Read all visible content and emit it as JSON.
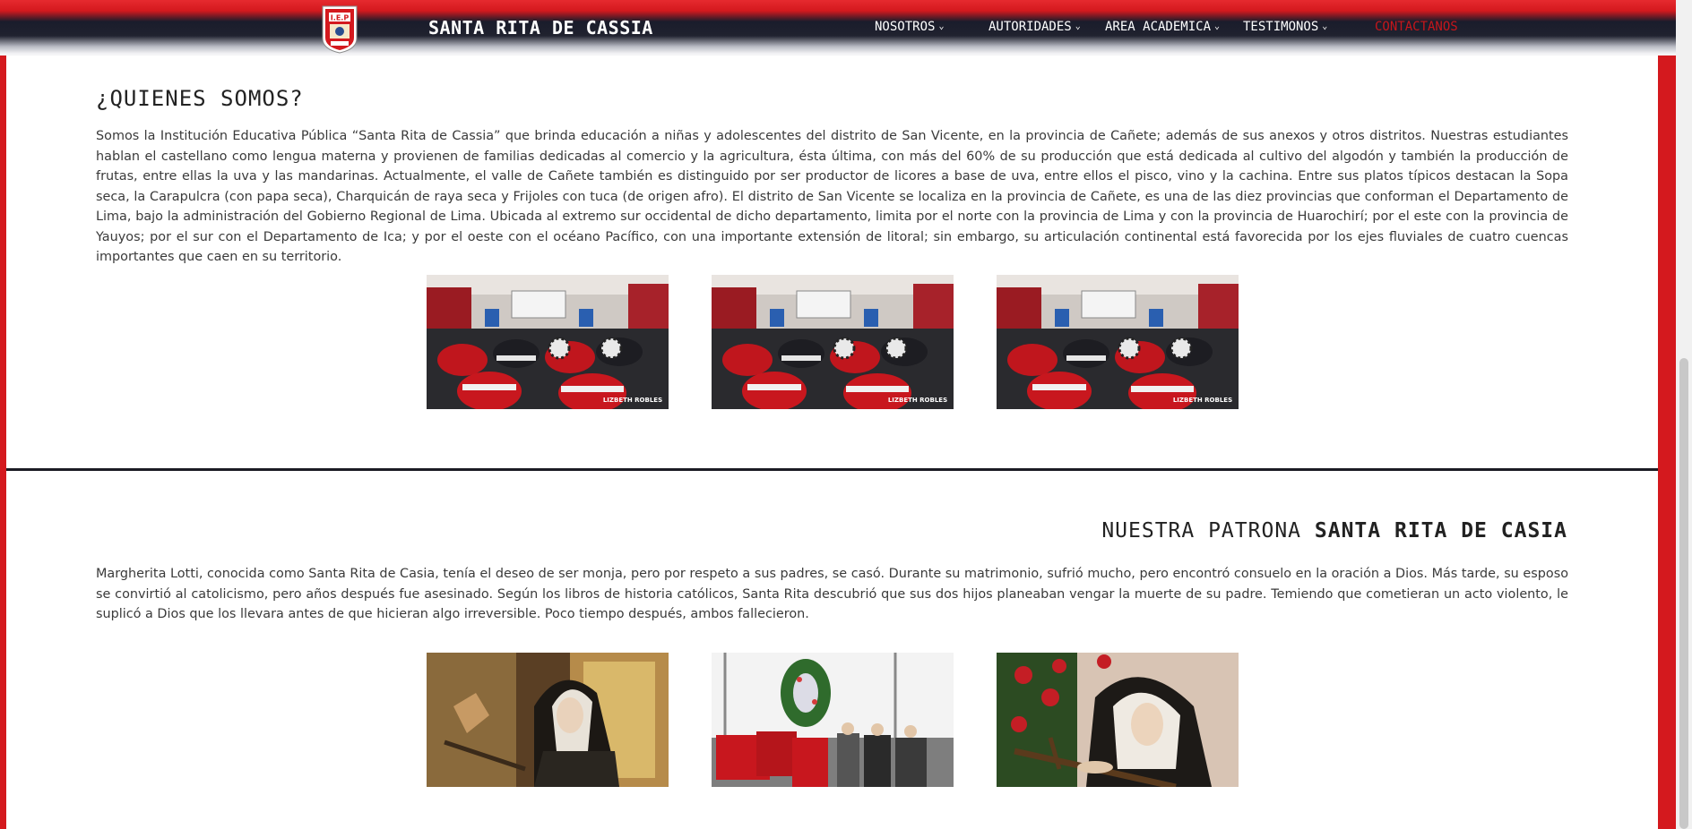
{
  "navbar": {
    "brand": "SANTA RITA DE CASSIA",
    "logo_text": "I.E.P",
    "items": [
      {
        "label": "NOSOTROS",
        "has_dropdown": true
      },
      {
        "label": "AUTORIDADES",
        "has_dropdown": true
      },
      {
        "label": "AREA ACADEMICA",
        "has_dropdown": true
      },
      {
        "label": "TESTIMONOS",
        "has_dropdown": true
      },
      {
        "label": "CONTACTANOS",
        "has_dropdown": false
      }
    ],
    "chevron_icon": "chevron-down-icon"
  },
  "quienes": {
    "title": "¿QUIENES SOMOS?",
    "text": "Somos la Institución Educativa Pública “Santa Rita de Cassia” que brinda educación a niñas y adolescentes del distrito de San Vicente, en la provincia de Cañete; además de sus anexos y otros distritos. Nuestras estudiantes hablan el castellano como lengua materna y provienen de familias dedicadas al comercio y la agricultura, ésta última, con más del 60% de su producción que está dedicada al cultivo del algodón y también la producción de frutas, entre ellas la uva y las mandarinas. Actualmente, el valle de Cañete también es distinguido por ser productor de licores a base de uva, entre ellos el pisco, vino y la cachina. Entre sus platos típicos destacan la Sopa seca, la Carapulcra (con papa seca), Charquicán de raya seca y Frijoles con tuca (de origen afro). El distrito de San Vicente se localiza en la provincia de Cañete, es una de las diez provincias que conforman el Departamento de Lima, bajo la administración del Gobierno Regional de Lima. Ubicada al extremo sur occidental de dicho departamento, limita por el norte con la provincia de Lima y con la provincia de Huarochirí; por el este con la provincia de Yauyos; por el sur con el Departamento de Ica; y por el oeste con el océano Pacífico, con una importante extensión de litoral; sin embargo, su articulación continental está favorecida por los ejes fluviales de cuatro cuencas importantes que caen en su territorio.",
    "photo_watermark": "LIZBETH ROBLES"
  },
  "patrona": {
    "title_light": "NUESTRA PATRONA",
    "title_bold": "SANTA RITA DE CASIA",
    "text": "Margherita Lotti, conocida como Santa Rita de Casia, tenía el deseo de ser monja, pero por respeto a sus padres, se casó. Durante su matrimonio, sufrió mucho, pero encontró consuelo en la oración a Dios. Más tarde, su esposo se convirtió al catolicismo, pero años después fue asesinado. Según los libros de historia católicos, Santa Rita descubrió que sus dos hijos planeaban vengar la muerte de su padre. Temiendo que cometieran un acto violento, le suplicó a Dios que los llevara antes de que hicieran algo irreversible. Poco tiempo después, ambos fallecieron."
  },
  "colors": {
    "brand_red": "#d4191e",
    "contact_red": "#c7161b",
    "navbar_dark": "#1a1c2b"
  }
}
